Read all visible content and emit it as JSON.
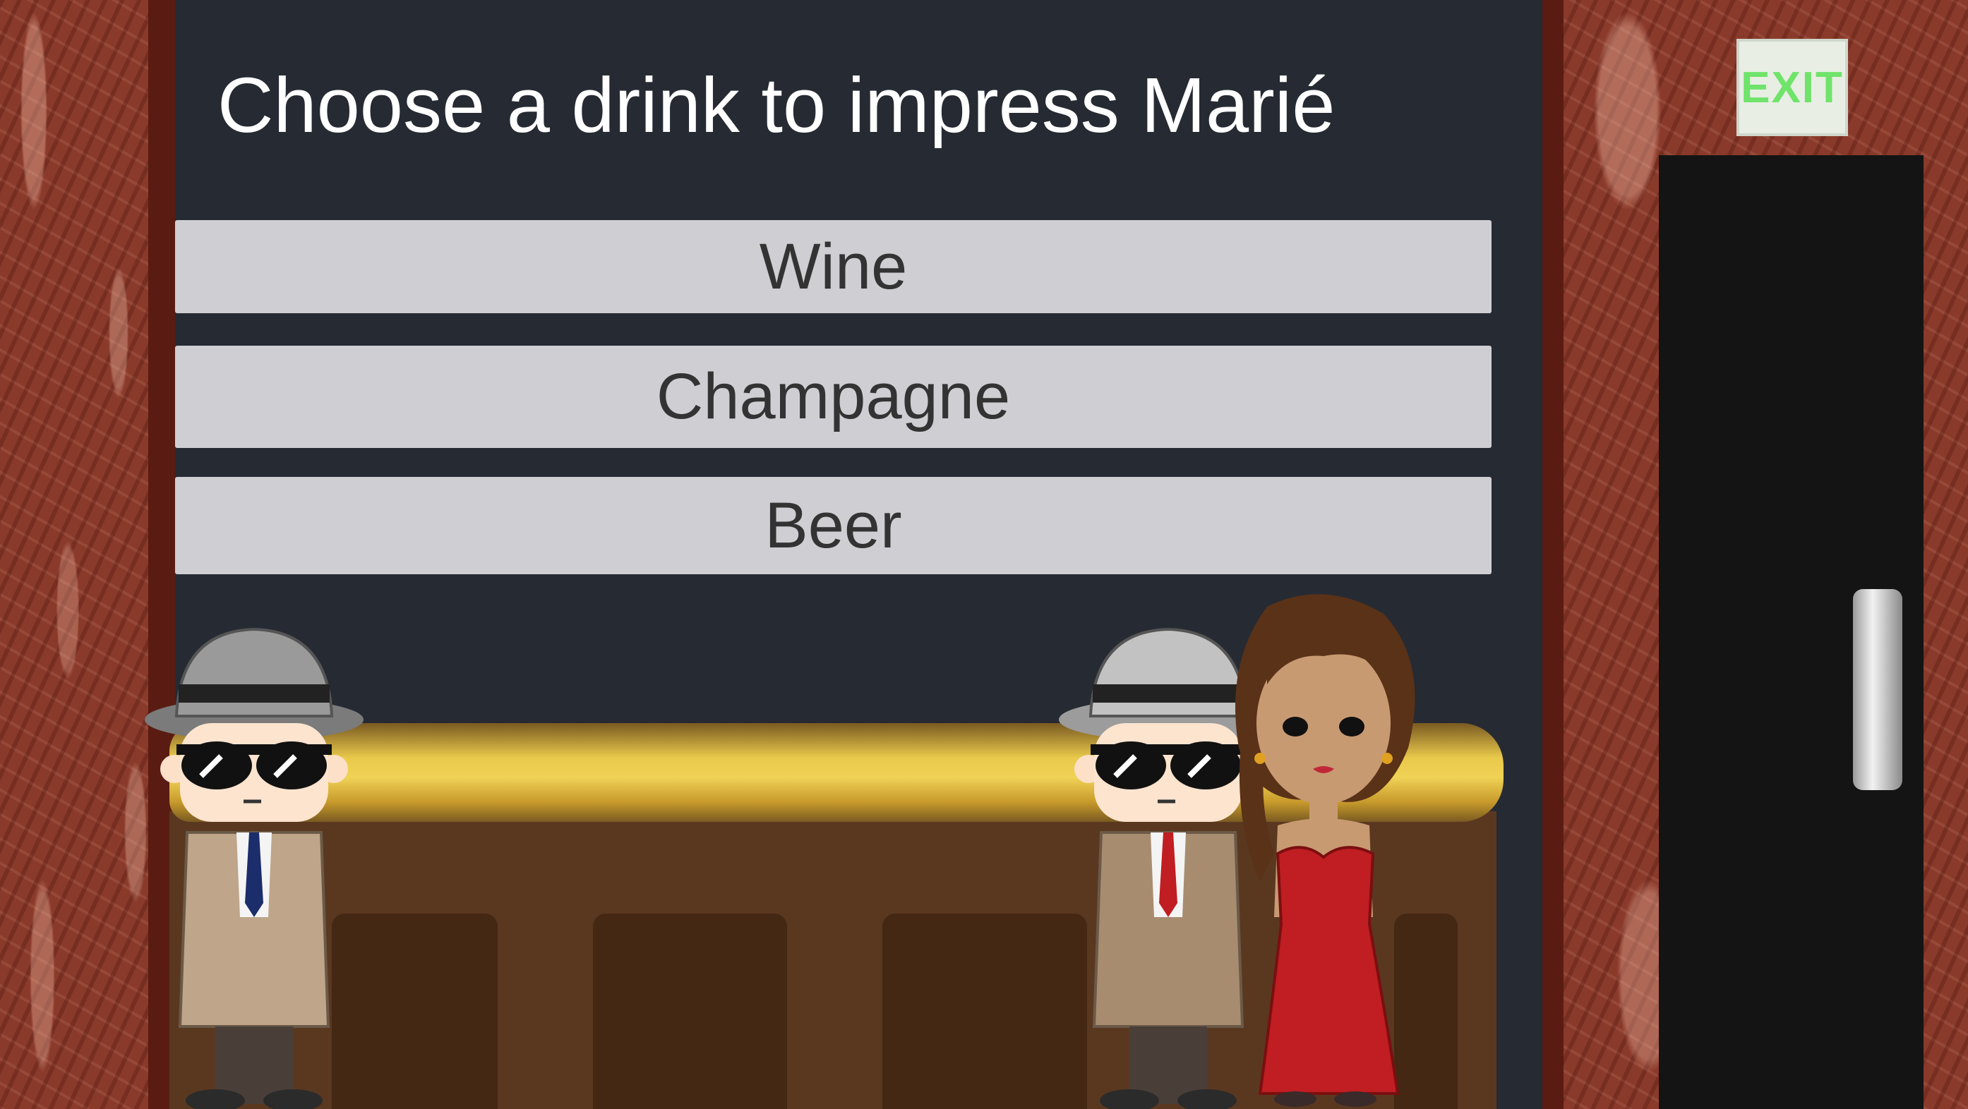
{
  "dialog": {
    "title": "Choose a drink to impress Marié",
    "choices": [
      {
        "label": "Wine"
      },
      {
        "label": "Champagne"
      },
      {
        "label": "Beer"
      }
    ]
  },
  "scene": {
    "exit_sign_text": "EXIT",
    "characters": [
      "detective-left",
      "detective-right",
      "marie"
    ],
    "colors": {
      "wall": "#8a3a2a",
      "backdrop": "#262a33",
      "counter_gold": "#e9c94a",
      "dress_red": "#c01e22",
      "choice_bg": "#d6d6da",
      "exit_green": "#6fe36a"
    }
  }
}
